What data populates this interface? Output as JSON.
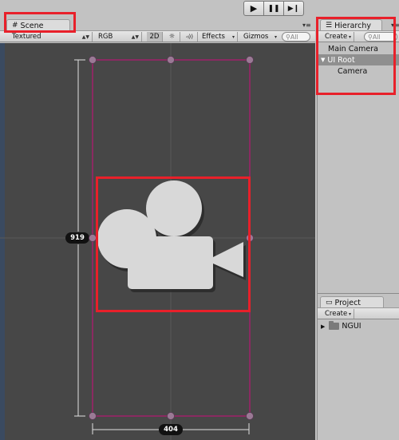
{
  "toolbar": {
    "play_icon": "play-icon",
    "pause_icon": "pause-icon",
    "step_icon": "step-icon",
    "play_glyph": "▶",
    "pause_glyph": "❚❚",
    "step_glyph": "▶❙"
  },
  "scene": {
    "tab_label": "Scene",
    "tab_icon": "#",
    "panel_menu": "▾≡",
    "shading_mode": "Textured",
    "render_mode": "RGB",
    "mode_2d": "2D",
    "lighting_icon": "☼",
    "audio_icon": "◃))",
    "effects_label": "Effects",
    "gizmos_label": "Gizmos",
    "search_placeholder": "All",
    "height_label": "919",
    "width_label": "404"
  },
  "hierarchy": {
    "tab_label": "Hierarchy",
    "tab_icon": "☰",
    "create_label": "Create",
    "search_placeholder": "All",
    "items": [
      {
        "label": "Main Camera",
        "level": 0,
        "selected": false
      },
      {
        "label": "UI Root",
        "level": 0,
        "selected": true,
        "expanded": true
      },
      {
        "label": "Camera",
        "level": 1,
        "selected": false
      }
    ]
  },
  "project": {
    "tab_label": "Project",
    "create_label": "Create",
    "items": [
      {
        "label": "NGUI",
        "type": "folder"
      }
    ]
  },
  "colors": {
    "viewport_bg": "#474747",
    "ui_frame": "#a0206a",
    "handle": "#9a7a95",
    "highlight": "#e8202a",
    "camera_icon": "#d8d8d8"
  }
}
